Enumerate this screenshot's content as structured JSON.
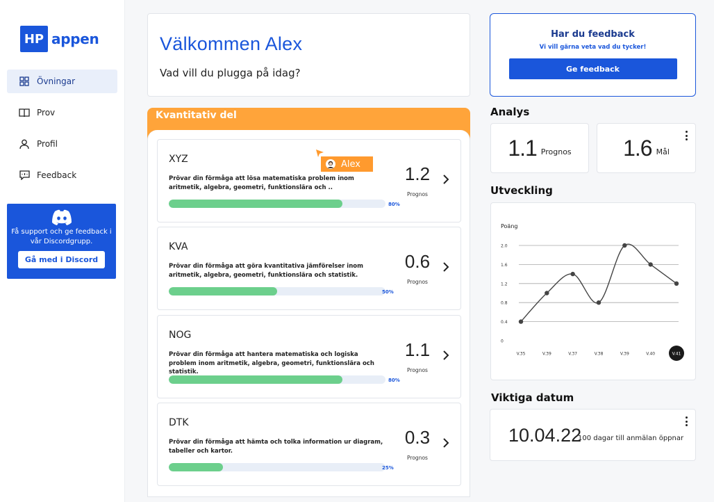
{
  "logo": {
    "badge": "HP",
    "text": "appen"
  },
  "sidebar": {
    "items": [
      {
        "label": "Övningar",
        "icon": "grid-icon",
        "active": true
      },
      {
        "label": "Prov",
        "icon": "book-icon",
        "active": false
      },
      {
        "label": "Profil",
        "icon": "user-icon",
        "active": false
      },
      {
        "label": "Feedback",
        "icon": "message-icon",
        "active": false
      }
    ],
    "discord": {
      "text": "Få support och ge feedback i vår Discordgrupp.",
      "button": "Gå med i Discord"
    }
  },
  "welcome": {
    "title": "Välkommen Alex",
    "subtitle": "Vad vill du plugga på idag?"
  },
  "quant": {
    "title": "Kvantitativ del",
    "cards": [
      {
        "title": "XYZ",
        "desc": "Prövar din förmåga att lösa matematiska problem inom aritmetik, algebra, geometri, funktionslära och ..",
        "progress": 80,
        "progress_label": "80%",
        "score": "1.2",
        "score_label": "Prognos"
      },
      {
        "title": "KVA",
        "desc": "Prövar din förmåga att göra kvantitativa jämförelser inom aritmetik, algebra, geometri, funktionslära och statistik.",
        "progress": 50,
        "progress_label": "50%",
        "score": "0.6",
        "score_label": "Prognos"
      },
      {
        "title": "NOG",
        "desc": "Prövar din förmåga att hantera matematiska och logiska problem inom aritmetik, algebra, geometri, funktionslära och statistik.",
        "progress": 80,
        "progress_label": "80%",
        "score": "1.1",
        "score_label": "Prognos"
      },
      {
        "title": "DTK",
        "desc": "Prövar din förmåga att hämta och tolka information ur diagram, tabeller och kartor.",
        "progress": 25,
        "progress_label": "25%",
        "score": "0.3",
        "score_label": "Prognos"
      }
    ]
  },
  "cursor_tag": {
    "name": "Alex"
  },
  "feedback": {
    "title": "Har du feedback",
    "subtitle": "Vi vill gärna veta vad du tycker!",
    "button": "Ge feedback"
  },
  "analys": {
    "title": "Analys",
    "prognos_value": "1.1",
    "prognos_label": "Prognos",
    "mal_value": "1.6",
    "mal_label": "Mål"
  },
  "utveckling": {
    "title": "Utveckling"
  },
  "chart_data": {
    "type": "line",
    "ylabel": "Poäng",
    "ylim": [
      0,
      2.0
    ],
    "yticks": [
      "0",
      "0.4",
      "0.8",
      "1.2",
      "1.6",
      "2.0"
    ],
    "categories": [
      "V.35",
      "V.39",
      "V.37",
      "V.38",
      "V.39",
      "V.40",
      "V.41"
    ],
    "values": [
      0.4,
      1.0,
      1.4,
      0.8,
      2.0,
      1.6,
      1.2
    ],
    "highlighted_category": "V.41",
    "colors": {
      "line": "#444444",
      "highlight": "#1a1a1a"
    }
  },
  "datum": {
    "title": "Viktiga datum",
    "date": "10.04.22",
    "note": "100 dagar till anmälan öppnar"
  },
  "colors": {
    "brand": "#1a56db",
    "accent": "#ffa43a",
    "progress": "#6ccf8c"
  }
}
